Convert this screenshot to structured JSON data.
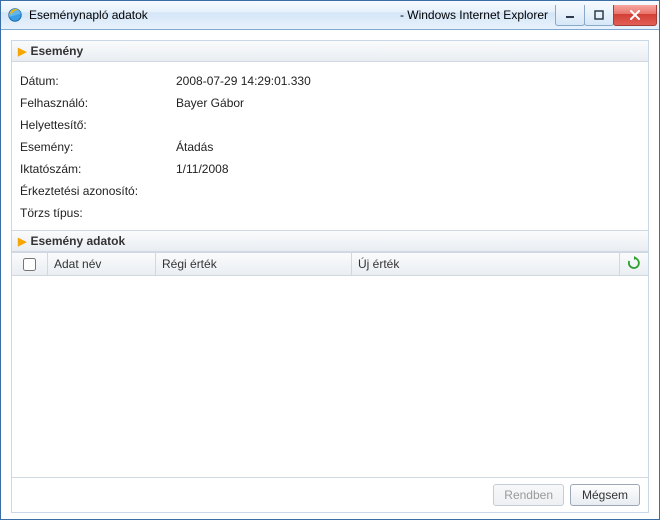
{
  "window": {
    "title": "Eseménynapló adatok",
    "app_suffix": "- Windows Internet Explorer",
    "controls": {
      "minimize": "min",
      "maximize": "max",
      "close": "close"
    }
  },
  "sections": {
    "event_title": "Esemény",
    "event_data_title": "Esemény adatok"
  },
  "fields": {
    "date": {
      "label": "Dátum:",
      "value": "2008-07-29 14:29:01.330"
    },
    "user": {
      "label": "Felhasználó:",
      "value": "Bayer Gábor"
    },
    "substitute": {
      "label": "Helyettesítő:",
      "value": ""
    },
    "event": {
      "label": "Esemény:",
      "value": "Átadás"
    },
    "refnum": {
      "label": "Iktatószám:",
      "value": "1/11/2008"
    },
    "arrival_id": {
      "label": "Érkeztetési azonosító:",
      "value": ""
    },
    "master_type": {
      "label": "Törzs típus:",
      "value": ""
    }
  },
  "grid": {
    "columns": {
      "name": "Adat név",
      "old": "Régi érték",
      "new": "Új érték"
    },
    "refresh_icon": "refresh"
  },
  "buttons": {
    "ok": "Rendben",
    "cancel": "Mégsem"
  }
}
